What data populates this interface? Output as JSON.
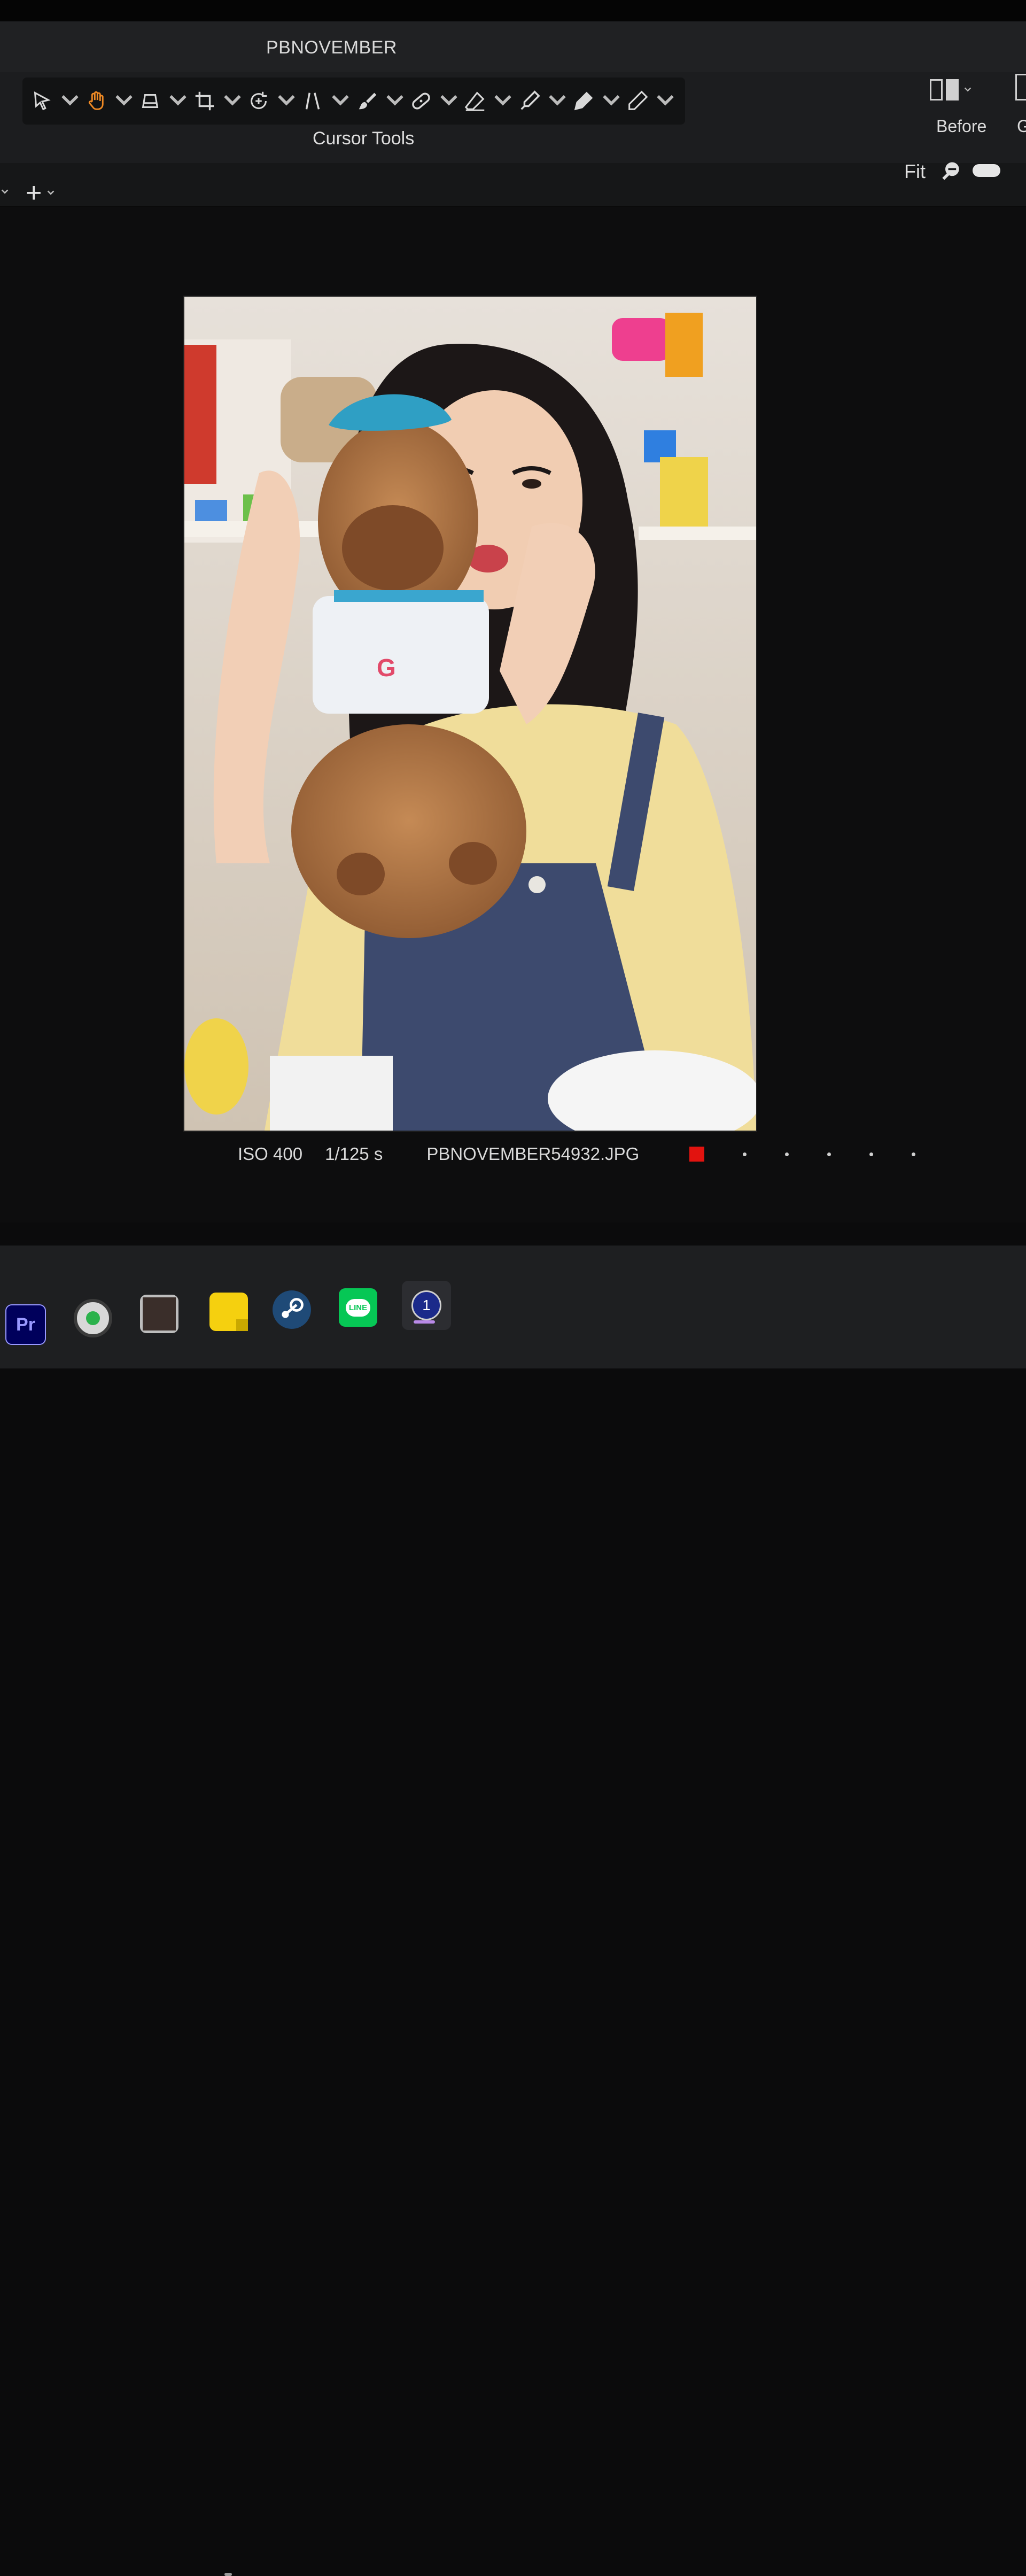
{
  "window": {
    "title": "PBNOVEMBER"
  },
  "toolbar": {
    "group_label": "Cursor Tools",
    "tools": [
      {
        "name": "select-icon"
      },
      {
        "name": "pan-hand-icon",
        "active": true
      },
      {
        "name": "straighten-icon"
      },
      {
        "name": "crop-icon"
      },
      {
        "name": "rotate-icon"
      },
      {
        "name": "keystone-icon"
      },
      {
        "name": "brush-icon"
      },
      {
        "name": "heal-icon"
      },
      {
        "name": "eraser-icon"
      },
      {
        "name": "picker-icon"
      },
      {
        "name": "fill-icon"
      },
      {
        "name": "pencil-icon"
      }
    ],
    "before_label": "Before",
    "cutoff_label": "G"
  },
  "viewer": {
    "zoom_label": "Fit",
    "add_label": "+"
  },
  "photo": {
    "iso": "ISO 400",
    "shutter": "1/125 s",
    "filename": "PBNOVEMBER54932.JPG",
    "color_label": "#e2130f",
    "rating_stars": 0,
    "rating_max": 5
  },
  "taskbar": {
    "apps": [
      {
        "name": "premiere-pro-icon",
        "label": "Pr"
      },
      {
        "name": "capture-app-icon"
      },
      {
        "name": "photo-viewer-icon"
      },
      {
        "name": "sticky-notes-icon"
      },
      {
        "name": "steam-icon"
      },
      {
        "name": "line-chat-icon",
        "label": "LINE"
      },
      {
        "name": "capture-one-icon",
        "label": "1"
      }
    ]
  },
  "colors": {
    "accent_orange": "#f08a24",
    "background": "#0d0d0e",
    "panel": "#1c1d1f"
  }
}
